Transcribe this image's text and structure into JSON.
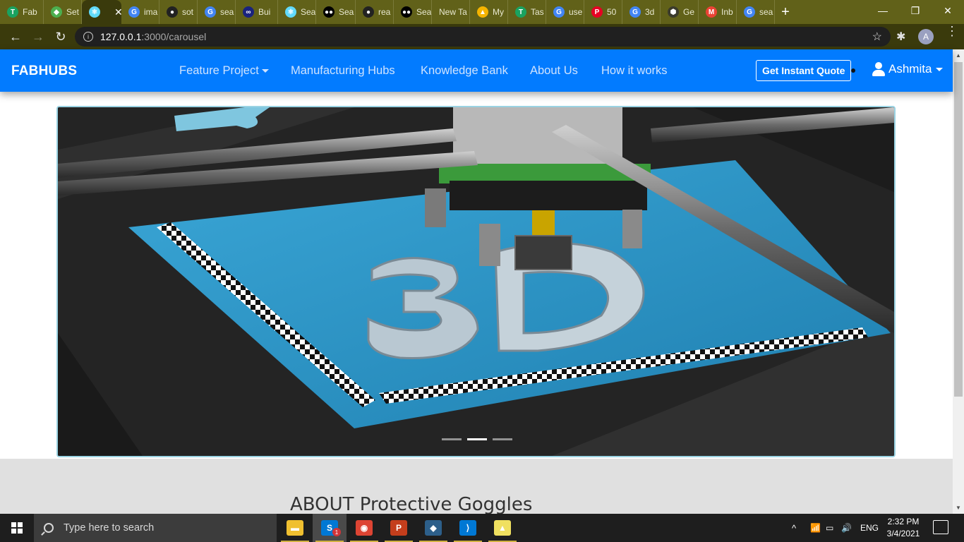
{
  "browser": {
    "tabs": [
      {
        "label": "Fab",
        "fav": "T",
        "color": "#1aa260"
      },
      {
        "label": "Set",
        "fav": "◆",
        "color": "#4caf50"
      },
      {
        "label": "",
        "fav": "⚛",
        "color": "#61dafb",
        "active": true
      },
      {
        "label": "ima",
        "fav": "G",
        "color": "#4285f4"
      },
      {
        "label": "sot",
        "fav": "●",
        "color": "#222222"
      },
      {
        "label": "sea",
        "fav": "G",
        "color": "#4285f4"
      },
      {
        "label": "Bui",
        "fav": "∞",
        "color": "#1a237e"
      },
      {
        "label": "Sea",
        "fav": "⚛",
        "color": "#61dafb"
      },
      {
        "label": "Sea",
        "fav": "●●",
        "color": "#000000"
      },
      {
        "label": "rea",
        "fav": "●",
        "color": "#222222"
      },
      {
        "label": "Sea",
        "fav": "●●",
        "color": "#000000"
      },
      {
        "label": "New Ta",
        "fav": "",
        "color": ""
      },
      {
        "label": "My",
        "fav": "▲",
        "color": "#f4b400"
      },
      {
        "label": "Tas",
        "fav": "T",
        "color": "#1aa260"
      },
      {
        "label": "use",
        "fav": "G",
        "color": "#4285f4"
      },
      {
        "label": "50",
        "fav": "P",
        "color": "#e60023"
      },
      {
        "label": "3d",
        "fav": "G",
        "color": "#4285f4"
      },
      {
        "label": "Ge",
        "fav": "⬢",
        "color": "#3b3b2b"
      },
      {
        "label": "Inb",
        "fav": "M",
        "color": "#ea4335"
      },
      {
        "label": "sea",
        "fav": "G",
        "color": "#4285f4"
      }
    ],
    "active_tab_close": "✕",
    "new_tab": "+",
    "window_controls": {
      "minimize": "—",
      "maximize": "❐",
      "close": "✕"
    },
    "nav": {
      "back": "←",
      "forward": "→",
      "reload": "↻"
    },
    "url": {
      "host": "127.0.0.1",
      "path": ":3000/carousel"
    },
    "bookmark_star": "☆",
    "extensions_icon": "✱",
    "profile_initial": "A",
    "menu": "⋮"
  },
  "site": {
    "brand": "FABHUBS",
    "nav_links": [
      "Feature Project",
      "Manufacturing Hubs",
      "Knowledge Bank",
      "About Us",
      "How it works"
    ],
    "quote_button": "Get Instant Quote",
    "user_name": "Ashmita"
  },
  "carousel": {
    "indicators": 3,
    "active_index": 1,
    "image_text": "3D"
  },
  "section": {
    "title": "ABOUT Protective Goggles"
  },
  "taskbar": {
    "search_placeholder": "Type here to search",
    "apps": [
      {
        "name": "file-explorer",
        "glyph": "▬",
        "color": "#f0c030"
      },
      {
        "name": "skype",
        "glyph": "S",
        "color": "#0078d4",
        "badge": "1",
        "active": true
      },
      {
        "name": "chrome",
        "glyph": "◉",
        "color": "#dd4433"
      },
      {
        "name": "powerpoint",
        "glyph": "P",
        "color": "#c43e1c"
      },
      {
        "name": "mysql-workbench",
        "glyph": "◆",
        "color": "#2d5f8a"
      },
      {
        "name": "vscode",
        "glyph": "⟩",
        "color": "#0078d4"
      },
      {
        "name": "chart-app",
        "glyph": "▲",
        "color": "#f0e060"
      }
    ],
    "language": "ENG",
    "time": "2:32 PM",
    "date": "3/4/2021",
    "tray_up": "^"
  }
}
